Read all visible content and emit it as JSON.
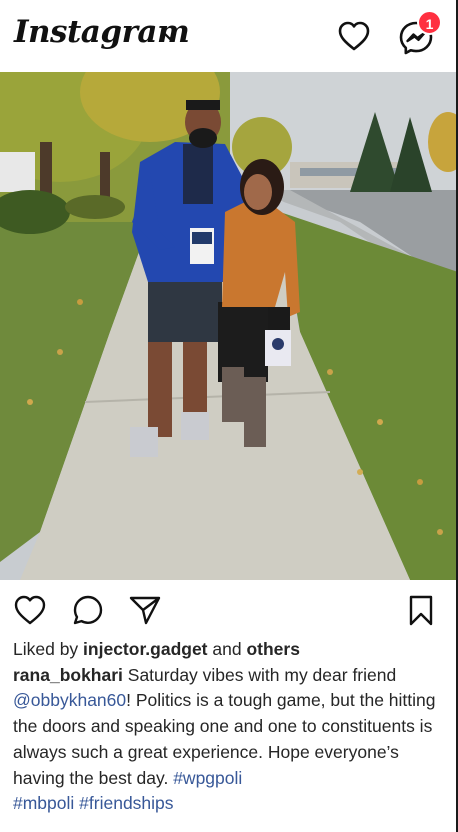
{
  "header": {
    "logo_text": "Instagram",
    "notification_count": "1",
    "icons": [
      "chevron-down-icon",
      "heart-icon",
      "messenger-icon"
    ]
  },
  "post": {
    "image_alt": "Two people standing on a sidewalk",
    "actions": [
      "like-icon",
      "comment-icon",
      "share-icon",
      "bookmark-icon"
    ],
    "likes": {
      "prefix": "Liked by ",
      "user": "injector.gadget",
      "middle": " and ",
      "others": "others"
    },
    "caption": {
      "author": "rana_bokhari",
      "text_1": " Saturday vibes with my dear friend ",
      "mention": "@obbykhan60",
      "text_2": "! Politics is a tough game, but the hitting the doors and speaking one and one to constituents is always such a great experience. Hope everyone’s having the best day. ",
      "hashtags": [
        "#wpgpoli",
        "#mbpoli",
        "#friendships"
      ]
    }
  },
  "colors": {
    "badge": "#ff3040",
    "link": "#385898",
    "text": "#262626"
  }
}
